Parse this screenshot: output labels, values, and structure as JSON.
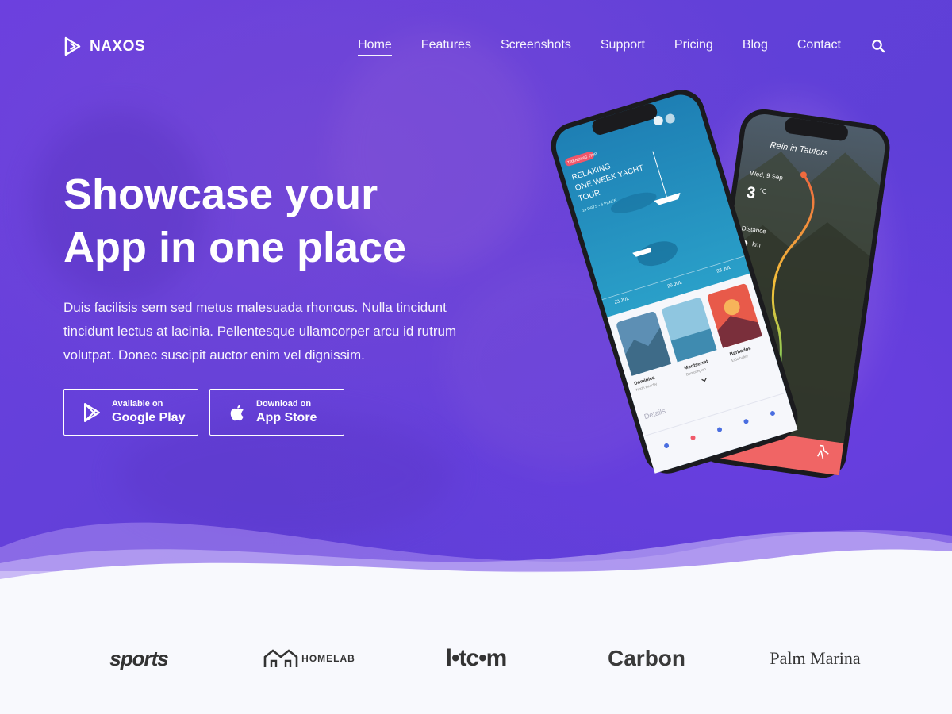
{
  "nav": {
    "brand": "NAXOS",
    "items": [
      {
        "label": "Home",
        "active": true
      },
      {
        "label": "Features"
      },
      {
        "label": "Screenshots"
      },
      {
        "label": "Support"
      },
      {
        "label": "Pricing"
      },
      {
        "label": "Blog"
      },
      {
        "label": "Contact"
      }
    ],
    "search_icon": "search-icon"
  },
  "hero": {
    "headline_line1": "Showcase your",
    "headline_line2": "App in one place",
    "subtext": "Duis facilisis sem sed metus malesuada rhoncus. Nulla tincidunt tincidunt lectus at lacinia. Pellentesque ullamcorper arcu id rutrum volutpat. Donec suscipit auctor enim vel dignissim.",
    "google_play": {
      "small": "Available on",
      "big": "Google Play",
      "icon": "google-play-icon"
    },
    "app_store": {
      "small": "Download on",
      "big": "App Store",
      "icon": "apple-icon"
    }
  },
  "phone_front": {
    "badge": "TRENDING TRIP",
    "title_l1": "RELAXING",
    "title_l2": "ONE WEEK YACHT",
    "title_l3": "TOUR",
    "meta": "14 DAYS • 6 PLACE",
    "dates": [
      "23 JUL",
      "25 JUL",
      "28 JUL"
    ],
    "cards": [
      {
        "name": "Dominica",
        "sub": "North Beachy"
      },
      {
        "name": "Montserrat",
        "sub": "Demurington"
      },
      {
        "name": "Barbados",
        "sub": "Eldorbaley"
      }
    ],
    "details": "Details"
  },
  "phone_back": {
    "title": "Rein in Taufers",
    "date": "Wed, 9 Sep",
    "temp": "3",
    "temp_unit": "°C",
    "distance_label": "Distance",
    "distance_value": "2",
    "distance_unit": "km"
  },
  "brands": [
    "sports",
    "HOMELAB",
    "l•tc•m",
    "Carbon",
    "Palm Marina"
  ],
  "colors": {
    "accent": "#6a42dc",
    "white": "#ffffff",
    "brand_grey": "#333333"
  }
}
